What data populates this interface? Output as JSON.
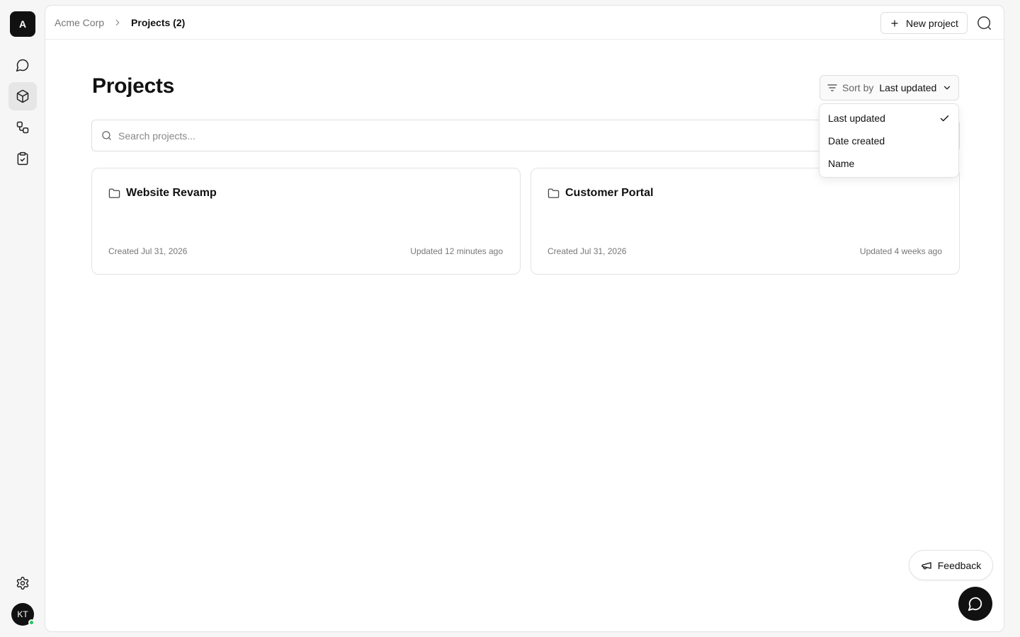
{
  "workspace": {
    "initial": "A"
  },
  "breadcrumb": {
    "org": "Acme Corp",
    "current": "Projects (2)"
  },
  "toolbar": {
    "new_project_label": "New project"
  },
  "page": {
    "title": "Projects"
  },
  "sort": {
    "prefix": "Sort by",
    "selected": "Last updated",
    "options": [
      {
        "label": "Last updated",
        "checked": true
      },
      {
        "label": "Date created",
        "checked": false
      },
      {
        "label": "Name",
        "checked": false
      }
    ]
  },
  "search": {
    "placeholder": "Search projects..."
  },
  "projects": [
    {
      "name": "Website Revamp",
      "created": "Created Jul 31, 2026",
      "updated": "Updated 12 minutes ago"
    },
    {
      "name": "Customer Portal",
      "created": "Created Jul 31, 2026",
      "updated": "Updated 4 weeks ago"
    }
  ],
  "user": {
    "initials": "KT",
    "status_color": "#22c55e"
  },
  "feedback": {
    "label": "Feedback"
  },
  "icons": {
    "rail": [
      "chat-icon",
      "cube-icon",
      "workflow-icon",
      "clipboard-check-icon",
      "gear-icon"
    ],
    "folder": "folder-icon"
  }
}
